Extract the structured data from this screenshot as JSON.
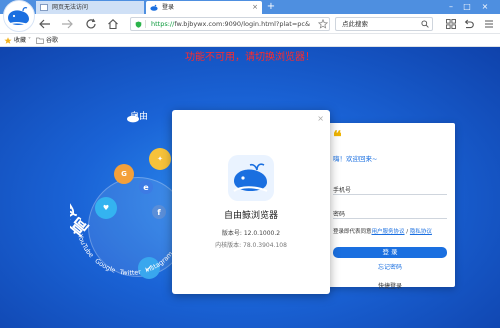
{
  "tabs": [
    {
      "title": "网页无法访问",
      "icon": "page-icon"
    },
    {
      "title": "登录",
      "icon": "whale-icon"
    }
  ],
  "toolbar": {
    "url_green": "https://",
    "url_rest": "fw.bjbywx.com:9090/login.html?plat=pc&",
    "search_placeholder": "点此搜索"
  },
  "bookmarks": [
    {
      "label": "收藏",
      "icon": "star-icon"
    },
    {
      "label": "谷歌",
      "icon": "folder-icon"
    }
  ],
  "page": {
    "warning": "功能不可用，请切换浏览器！",
    "slogan": "高速畅游~",
    "brand_partial": "自由",
    "social_labels": [
      "YouTube",
      "Google",
      "Twitter",
      "Instagram"
    ]
  },
  "about_dialog": {
    "app_name": "自由鲸浏览器",
    "version_label": "版本号: 12.0.1000.2",
    "kernel_label": "内核版本: 78.0.3904.108"
  },
  "login": {
    "welcome": "嗨！欢迎回来~",
    "phone_label": "手机号",
    "password_label": "密码",
    "agree_prefix": "登录即代表同意",
    "agree_terms": "用户服务协议",
    "agree_sep": " / ",
    "agree_privacy": "隐私协议",
    "login_button": "登 录",
    "forgot_password": "忘记密码",
    "quick_login": "快捷登录"
  },
  "colors": {
    "primary": "#1a6fe0",
    "warning": "#ff2a2a",
    "tabbar": "#4e8fe0",
    "quote": "#f0b400"
  }
}
